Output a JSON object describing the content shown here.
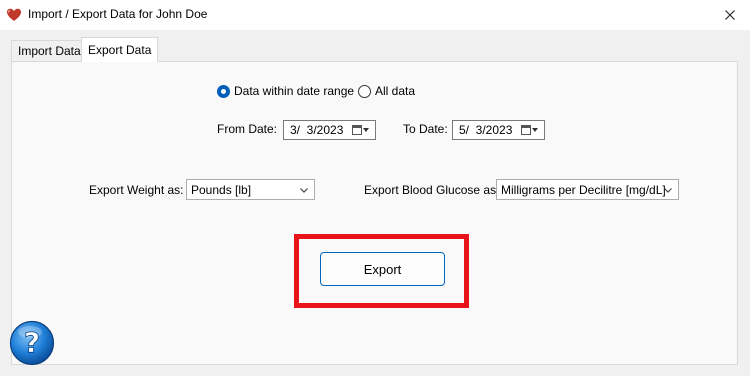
{
  "window": {
    "title": "Import / Export Data for John Doe",
    "icon": "heart-icon",
    "close_icon": "close-icon"
  },
  "tabs": [
    {
      "label": "Import Data",
      "active": false
    },
    {
      "label": "Export Data",
      "active": true
    }
  ],
  "range": {
    "option_range": "Data within date range",
    "option_all": "All data",
    "selected": "option_range"
  },
  "dates": {
    "from_label": "From Date:",
    "from_value": "3/  3/2023",
    "to_label": "To Date:",
    "to_value": "5/  3/2023"
  },
  "weight": {
    "label": "Export Weight as:",
    "value": "Pounds [lb]"
  },
  "glucose": {
    "label": "Export Blood Glucose as:",
    "value": "Milligrams per Decilitre [mg/dL]"
  },
  "actions": {
    "export_label": "Export"
  },
  "help": {
    "glyph": "?",
    "icon": "help-icon"
  },
  "colors": {
    "accent": "#005fb8",
    "highlight": "#e8141a",
    "help_blue": "#1f7fd8"
  }
}
